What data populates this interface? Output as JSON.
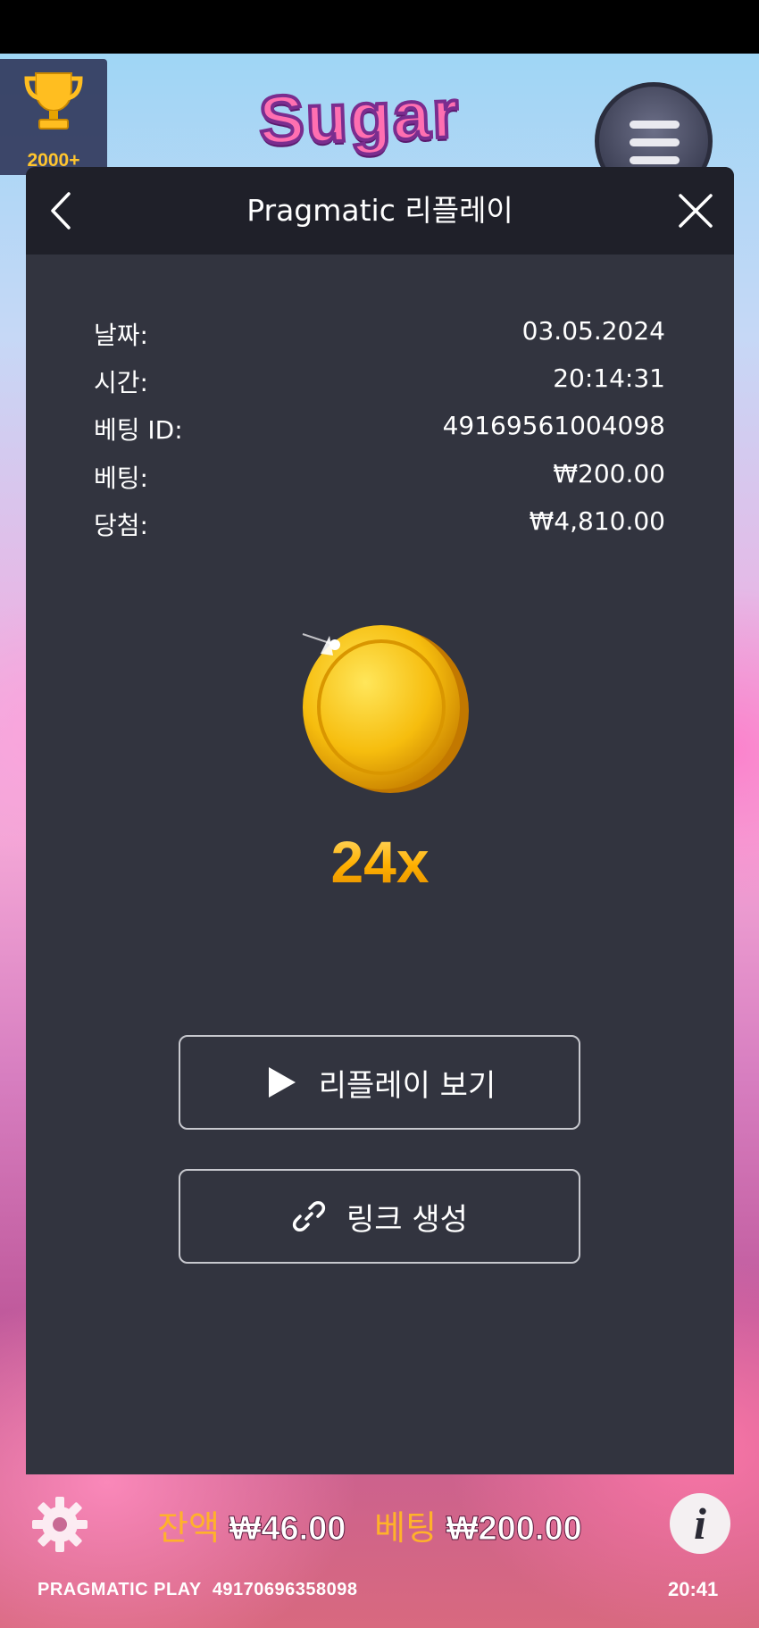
{
  "game": {
    "logo_text": "Sugar",
    "trophy_count": "2000+"
  },
  "modal": {
    "title": "Pragmatic 리플레이",
    "rows": [
      {
        "label": "날짜:",
        "value": "03.05.2024"
      },
      {
        "label": "시간:",
        "value": "20:14:31"
      },
      {
        "label": "베팅 ID:",
        "value": "49169561004098"
      },
      {
        "label": "베팅:",
        "value": "₩200.00"
      },
      {
        "label": "당첨:",
        "value": "₩4,810.00"
      }
    ],
    "multiplier": "24x",
    "watch_replay_label": "리플레이 보기",
    "create_link_label": "링크 생성"
  },
  "bottom_bar": {
    "balance_label": "잔액",
    "balance_value": "₩46.00",
    "bet_label": "베팅",
    "bet_value": "₩200.00",
    "provider": "PRAGMATIC PLAY",
    "round_id": "49170696358098",
    "clock": "20:41"
  },
  "colors": {
    "modal_bg": "#32343f",
    "header_bg": "#1f2029",
    "accent_gold": "#ffb22a"
  },
  "icons": [
    "trophy-icon",
    "menu-icon",
    "back-icon",
    "close-icon",
    "coin-icon",
    "play-icon",
    "link-icon",
    "gear-icon",
    "info-icon"
  ]
}
